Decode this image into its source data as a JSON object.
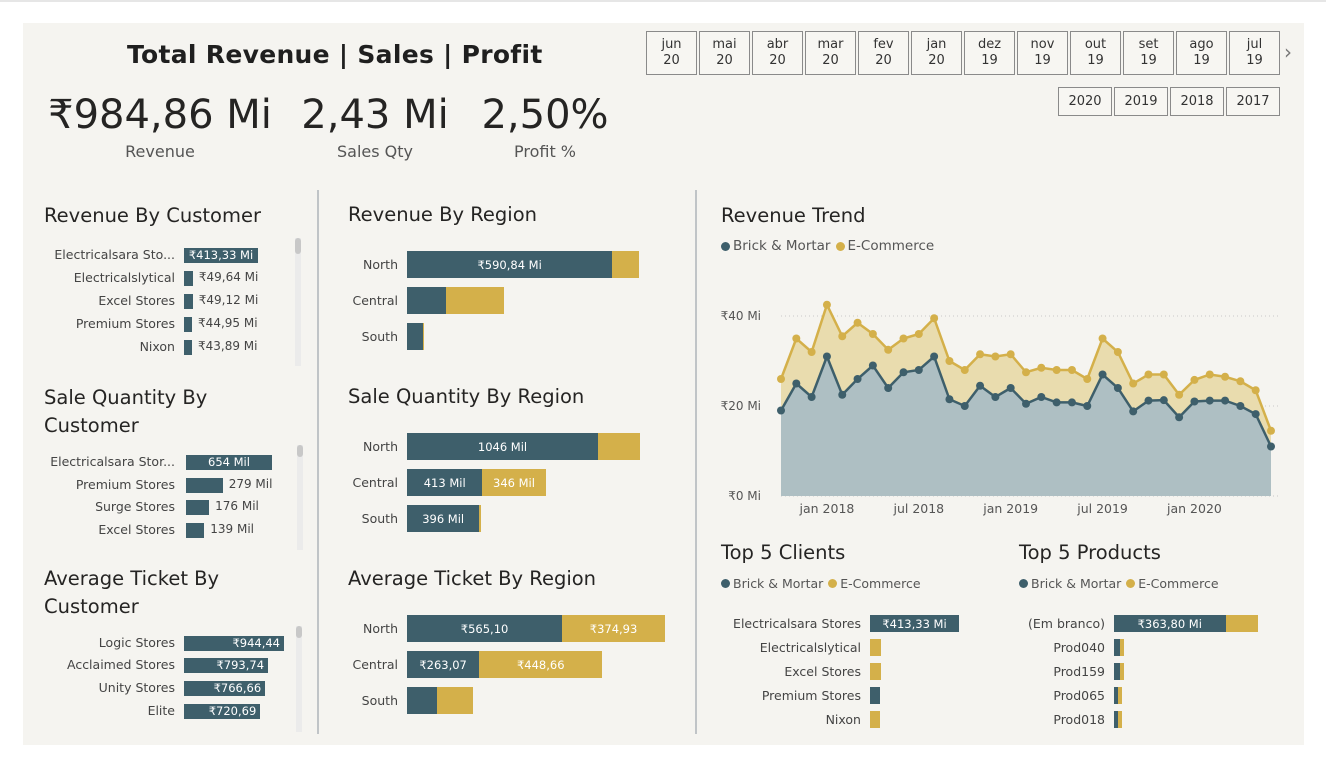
{
  "header": {
    "title": "Total Revenue | Sales | Profit"
  },
  "kpis": [
    {
      "value": "₹984,86 Mi",
      "label": "Revenue"
    },
    {
      "value": "2,43 Mi",
      "label": "Sales Qty"
    },
    {
      "value": "2,50%",
      "label": "Profit %"
    }
  ],
  "month_slicer": [
    {
      "m": "jun",
      "y": "20"
    },
    {
      "m": "mai",
      "y": "20"
    },
    {
      "m": "abr",
      "y": "20"
    },
    {
      "m": "mar",
      "y": "20"
    },
    {
      "m": "fev",
      "y": "20"
    },
    {
      "m": "jan",
      "y": "20"
    },
    {
      "m": "dez",
      "y": "19"
    },
    {
      "m": "nov",
      "y": "19"
    },
    {
      "m": "out",
      "y": "19"
    },
    {
      "m": "set",
      "y": "19"
    },
    {
      "m": "ago",
      "y": "19"
    },
    {
      "m": "jul",
      "y": "19"
    }
  ],
  "year_slicer": [
    "2020",
    "2019",
    "2018",
    "2017"
  ],
  "colors": {
    "brick": "#3e5f6b",
    "ecom": "#d4b04a",
    "canvas": "#f5f4f0",
    "area_brick": "#aebfc3",
    "area_ecom": "#e9dcae"
  },
  "icons": {
    "next": "chevron-right-icon"
  },
  "revenue_by_customer": {
    "title": "Revenue By Customer",
    "rows": [
      {
        "name": "Electricalsara Sto...",
        "label": "₹413,33 Mi",
        "value": 413.33
      },
      {
        "name": "Electricalslytical",
        "label": "₹49,64 Mi",
        "value": 49.64
      },
      {
        "name": "Excel Stores",
        "label": "₹49,12 Mi",
        "value": 49.12
      },
      {
        "name": "Premium Stores",
        "label": "₹44,95 Mi",
        "value": 44.95
      },
      {
        "name": "Nixon",
        "label": "₹43,89 Mi",
        "value": 43.89
      }
    ]
  },
  "sale_qty_by_customer": {
    "title_line1": "Sale Quantity By",
    "title_line2": "Customer",
    "rows": [
      {
        "name": "Electricalsara Stor...",
        "label": "654 Mil",
        "value": 654
      },
      {
        "name": "Premium Stores",
        "label": "279 Mil",
        "value": 279
      },
      {
        "name": "Surge Stores",
        "label": "176 Mil",
        "value": 176
      },
      {
        "name": "Excel Stores",
        "label": "139 Mil",
        "value": 139
      }
    ]
  },
  "avg_ticket_by_customer": {
    "title_line1": "Average Ticket By",
    "title_line2": "Customer",
    "rows": [
      {
        "name": "Logic Stores",
        "label": "₹944,44",
        "value": 944.44
      },
      {
        "name": "Acclaimed Stores",
        "label": "₹793,74",
        "value": 793.74
      },
      {
        "name": "Unity Stores",
        "label": "₹766,66",
        "value": 766.66
      },
      {
        "name": "Elite",
        "label": "₹720,69",
        "value": 720.69
      }
    ]
  },
  "revenue_by_region": {
    "title": "Revenue By Region",
    "rows": [
      {
        "name": "North",
        "brick": 590.84,
        "ecom": 77,
        "brick_label": "₹590,84 Mi",
        "ecom_label": ""
      },
      {
        "name": "Central",
        "brick": 112,
        "ecom": 167,
        "brick_label": "",
        "ecom_label": ""
      },
      {
        "name": "South",
        "brick": 46,
        "ecom": 2,
        "brick_label": "",
        "ecom_label": ""
      }
    ]
  },
  "sale_qty_by_region": {
    "title": "Sale Quantity By Region",
    "rows": [
      {
        "name": "North",
        "brick": 1046,
        "ecom": 230,
        "brick_label": "1046 Mil",
        "ecom_label": ""
      },
      {
        "name": "Central",
        "brick": 413,
        "ecom": 346,
        "brick_label": "413 Mil",
        "ecom_label": "346 Mil"
      },
      {
        "name": "South",
        "brick": 396,
        "ecom": 10,
        "brick_label": "396 Mil",
        "ecom_label": ""
      }
    ]
  },
  "avg_ticket_by_region": {
    "title": "Average Ticket By Region",
    "rows": [
      {
        "name": "North",
        "brick": 565.1,
        "ecom": 374.93,
        "brick_label": "₹565,10",
        "ecom_label": "₹374,93"
      },
      {
        "name": "Central",
        "brick": 263.07,
        "ecom": 448.66,
        "brick_label": "₹263,07",
        "ecom_label": "₹448,66"
      },
      {
        "name": "South",
        "brick": 110,
        "ecom": 130,
        "brick_label": "",
        "ecom_label": ""
      }
    ]
  },
  "revenue_trend": {
    "title": "Revenue Trend",
    "legend": [
      "Brick & Mortar",
      "E-Commerce"
    ],
    "y_ticks": [
      "₹0 Mi",
      "₹20 Mi",
      "₹40 Mi"
    ],
    "x_ticks": [
      "jan 2018",
      "jul 2018",
      "jan 2019",
      "jul 2019",
      "jan 2020"
    ]
  },
  "top5_clients": {
    "title": "Top 5 Clients",
    "legend": [
      "Brick & Mortar",
      "E-Commerce"
    ],
    "rows": [
      {
        "name": "Electricalsara Stores",
        "brick": 413.33,
        "ecom": 0,
        "label": "₹413,33 Mi"
      },
      {
        "name": "Electricalslytical",
        "brick": 0,
        "ecom": 49.64,
        "label": ""
      },
      {
        "name": "Excel Stores",
        "brick": 0,
        "ecom": 49.12,
        "label": ""
      },
      {
        "name": "Premium Stores",
        "brick": 44.95,
        "ecom": 0,
        "label": ""
      },
      {
        "name": "Nixon",
        "brick": 0,
        "ecom": 43.89,
        "label": ""
      }
    ]
  },
  "top5_products": {
    "title": "Top 5 Products",
    "legend": [
      "Brick & Mortar",
      "E-Commerce"
    ],
    "rows": [
      {
        "name": "(Em branco)",
        "brick": 363.8,
        "ecom": 106,
        "label": "₹363,80 Mi"
      },
      {
        "name": "Prod040",
        "brick": 20,
        "ecom": 2,
        "label": ""
      },
      {
        "name": "Prod159",
        "brick": 18,
        "ecom": 2,
        "label": ""
      },
      {
        "name": "Prod065",
        "brick": 6,
        "ecom": 12,
        "label": ""
      },
      {
        "name": "Prod018",
        "brick": 8,
        "ecom": 9,
        "label": ""
      }
    ]
  },
  "chart_data": {
    "type": "area",
    "title": "Revenue Trend",
    "x": [
      "2017-10",
      "2017-11",
      "2017-12",
      "2018-01",
      "2018-02",
      "2018-03",
      "2018-04",
      "2018-05",
      "2018-06",
      "2018-07",
      "2018-08",
      "2018-09",
      "2018-10",
      "2018-11",
      "2018-12",
      "2019-01",
      "2019-02",
      "2019-03",
      "2019-04",
      "2019-05",
      "2019-06",
      "2019-07",
      "2019-08",
      "2019-09",
      "2019-10",
      "2019-11",
      "2019-12",
      "2020-01",
      "2020-02",
      "2020-03",
      "2020-04",
      "2020-05",
      "2020-06"
    ],
    "series": [
      {
        "name": "Brick & Mortar",
        "values": [
          19,
          25,
          22,
          31,
          22.5,
          26,
          29,
          24,
          27.5,
          28,
          31,
          21.5,
          20,
          24.5,
          22,
          24,
          20.5,
          22,
          20.8,
          20.8,
          20,
          27,
          24,
          18.8,
          21.2,
          21.3,
          17.5,
          21,
          21.2,
          21.2,
          20,
          18.2,
          11
        ]
      },
      {
        "name": "E-Commerce",
        "values": [
          26,
          35,
          32,
          42.5,
          35.5,
          38.5,
          36,
          32.5,
          35,
          36,
          39.5,
          30,
          28,
          31.5,
          31,
          31.5,
          27.5,
          28.5,
          28,
          28,
          26,
          35,
          32,
          25,
          27,
          27,
          22.5,
          25.8,
          27,
          26.5,
          25.5,
          23.5,
          14.5
        ]
      }
    ],
    "ylim": [
      0,
      48
    ],
    "y_ticks": [
      0,
      20,
      40
    ],
    "legend_position": "top-left"
  }
}
